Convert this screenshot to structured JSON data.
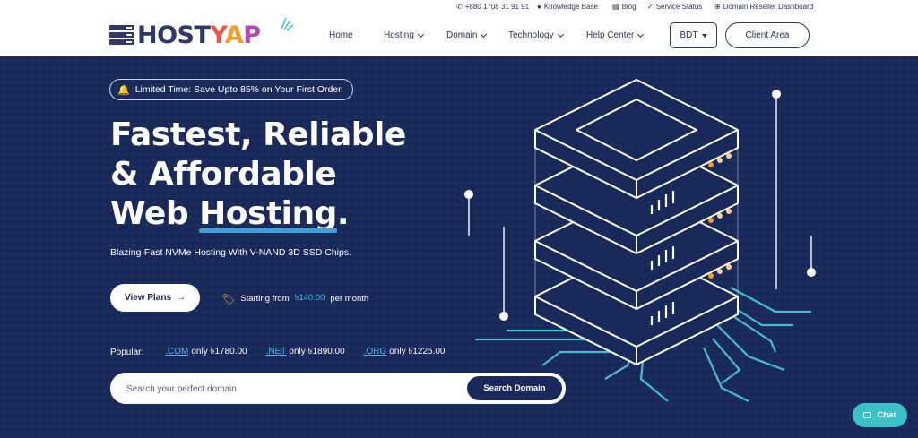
{
  "topbar": {
    "phone": "+880 1708 31 91 91",
    "knowledge_base": "Knowledge Base",
    "blog": "Blog",
    "service_status": "Service Status",
    "reseller": "Domain Reseller Dashboard"
  },
  "brand": {
    "host": "HOST",
    "y": "Y",
    "a": "A",
    "p": "P",
    "colors": {
      "navy": "#2d3a66",
      "red": "#e8564a",
      "orange": "#f39b2c",
      "purple": "#b349b6",
      "teal": "#3cc1c8"
    }
  },
  "nav": {
    "home": "Home",
    "hosting": "Hosting",
    "domain": "Domain",
    "technology": "Technology",
    "help": "Help Center",
    "currency": "BDT",
    "client_area": "Client Area"
  },
  "hero": {
    "promo": "Limited Time: Save Upto 85% on Your First Order.",
    "headline_1": "Fastest, Reliable",
    "headline_2": "& Affordable",
    "headline_3a": "Web ",
    "headline_3b": "Hosting",
    "headline_3c": ".",
    "subline": "Blazing-Fast NVMe Hosting With V-NAND 3D SSD Chips.",
    "view_plans": "View Plans",
    "starting_from": "Starting from",
    "start_price": "৳140.00",
    "per_month": "per month",
    "popular_label": "Popular:",
    "tlds": [
      {
        "tld": ".COM",
        "text": "only ৳1780.00"
      },
      {
        "tld": ".NET",
        "text": "only ৳1890.00"
      },
      {
        "tld": ".ORG",
        "text": "only ৳1225.00"
      }
    ],
    "search_placeholder": "Search your perfect domain",
    "search_button": "Search Domain"
  },
  "chat": {
    "label": "Chat"
  }
}
